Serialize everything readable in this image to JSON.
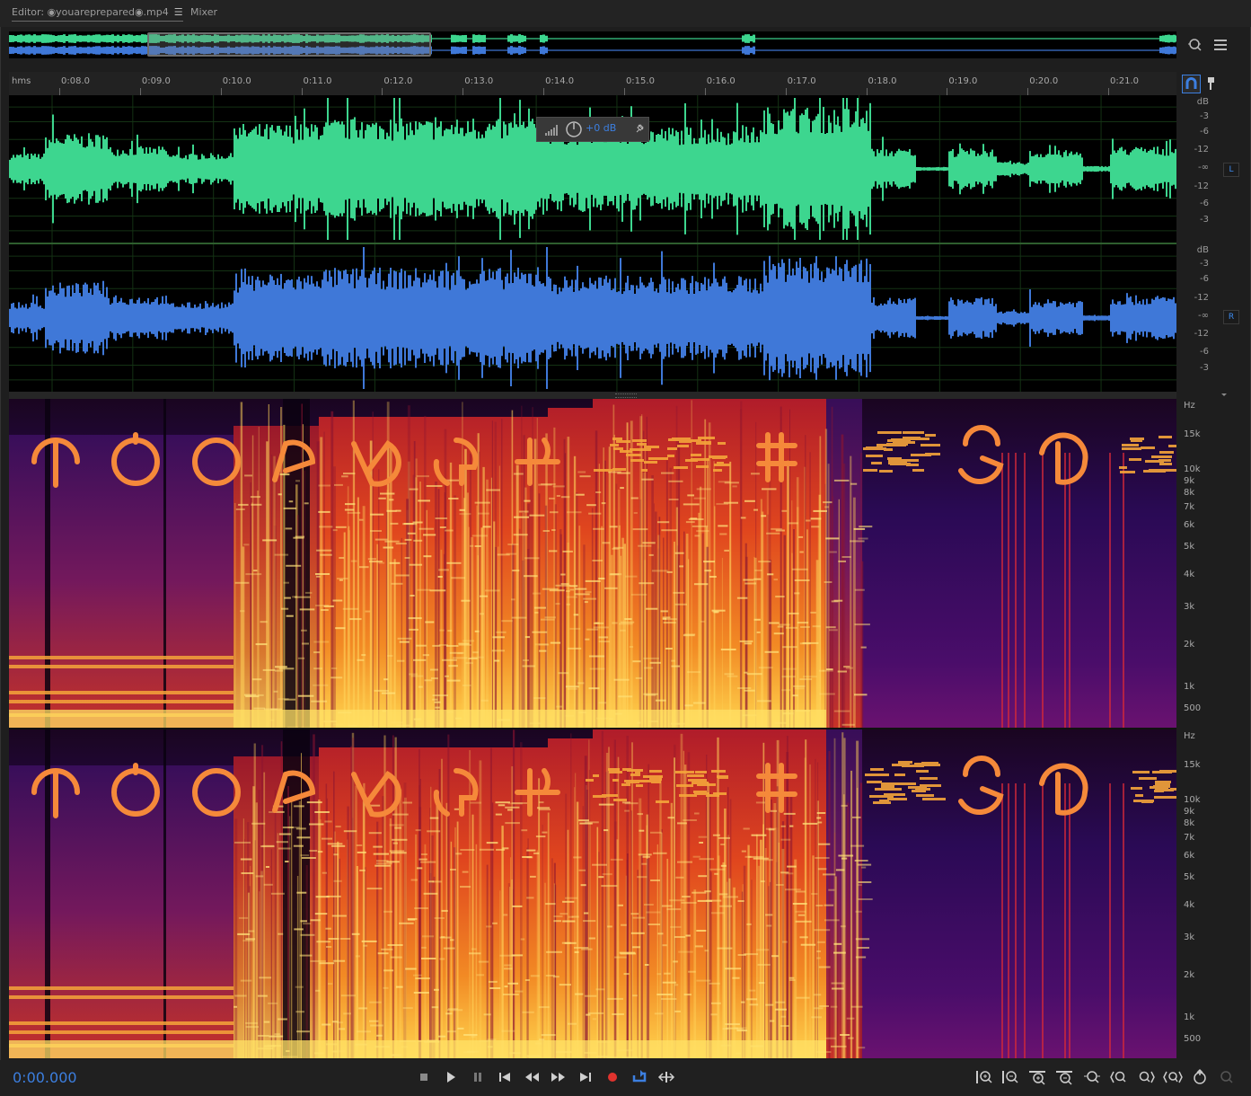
{
  "tabs": {
    "editor_label": "Editor: ◉youareprepared◉.mp4",
    "editor_menu": "☰",
    "mixer_label": "Mixer"
  },
  "ruler": {
    "unit": "hms",
    "ticks": [
      "0:08.0",
      "0:09.0",
      "0:10.0",
      "0:11.0",
      "0:12.0",
      "0:13.0",
      "0:14.0",
      "0:15.0",
      "0:16.0",
      "0:17.0",
      "0:18.0",
      "0:19.0",
      "0:20.0",
      "0:21.0"
    ]
  },
  "hud": {
    "gain": "+0 dB"
  },
  "channels": {
    "left": {
      "label": "L",
      "scale": [
        "dB",
        "-3",
        "-6",
        "-12",
        "-∞",
        "-12",
        "-6",
        "-3"
      ]
    },
    "right": {
      "label": "R",
      "scale": [
        "dB",
        "-3",
        "-6",
        "-12",
        "-∞",
        "-12",
        "-6",
        "-3"
      ]
    }
  },
  "spectral": {
    "scale": [
      "Hz",
      "15k",
      "10k",
      "9k",
      "8k",
      "7k",
      "6k",
      "5k",
      "4k",
      "3k",
      "2k",
      "1k",
      "500"
    ]
  },
  "transport": {
    "timecode": "0:00.000"
  },
  "colors": {
    "left_waveform": "#3dd68f",
    "right_waveform": "#3f78d8",
    "accent": "#3c7fe0",
    "record": "#e0332e"
  },
  "icons": {
    "overview": [
      "zoom-to-selection-icon",
      "panel-menu-icon"
    ],
    "ruler": [
      "snap-magnet-icon",
      "marker-pin-icon"
    ],
    "transport": [
      "stop-icon",
      "play-icon",
      "pause-icon",
      "go-to-start-icon",
      "rewind-icon",
      "fast-forward-icon",
      "go-to-end-icon",
      "record-icon",
      "loop-icon",
      "skip-selection-icon"
    ],
    "zoom": [
      "zoom-in-amplitude-icon",
      "zoom-out-amplitude-icon",
      "zoom-in-time-icon",
      "zoom-out-time-icon",
      "zoom-out-full-icon",
      "zoom-in-left-icon",
      "zoom-in-right-icon",
      "zoom-selection-icon",
      "zoom-reset-icon",
      "zoom-disabled-icon"
    ]
  }
}
